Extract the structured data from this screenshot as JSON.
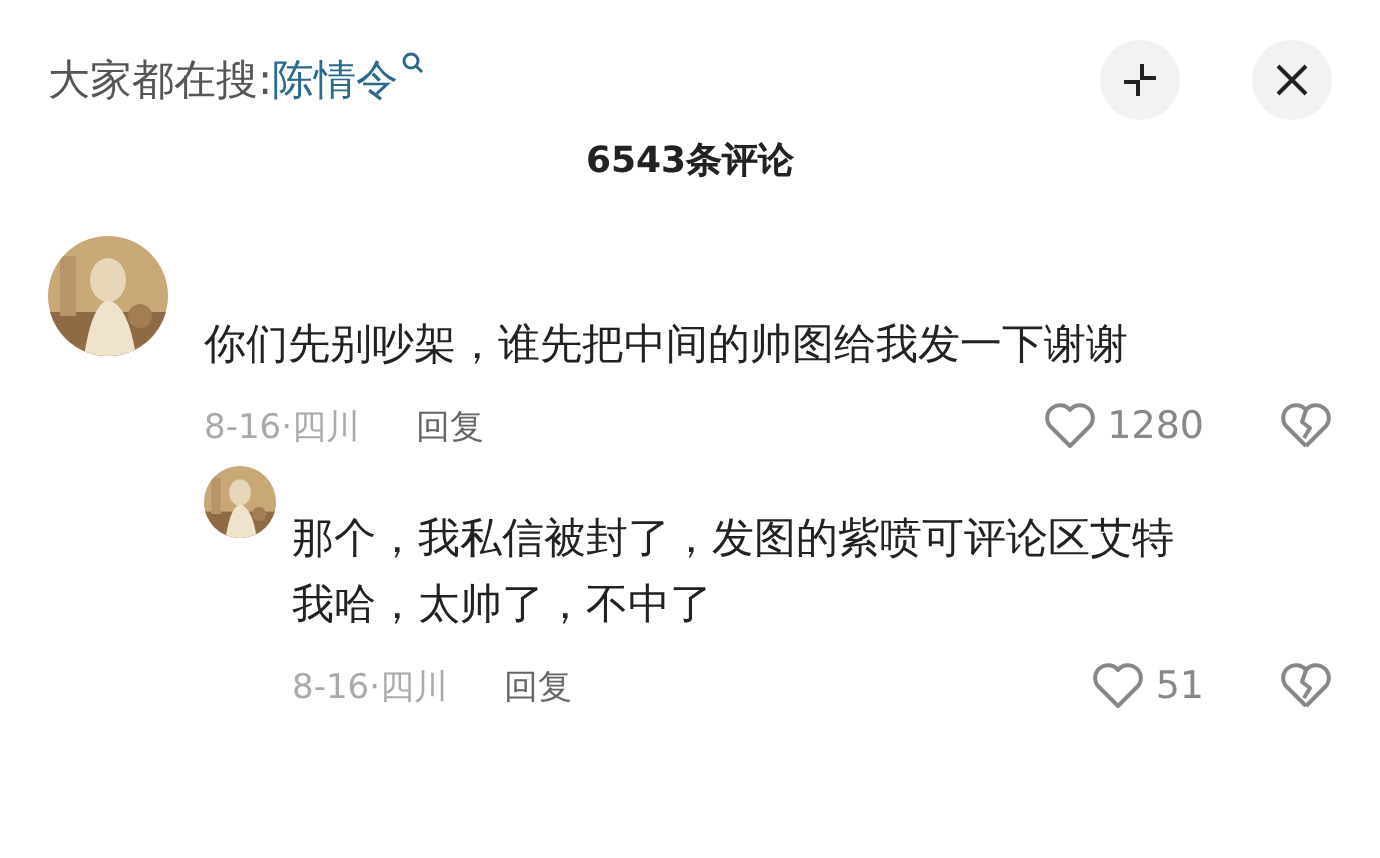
{
  "header": {
    "label": "大家都在搜:",
    "search_term": "陈情令"
  },
  "title": "6543条评论",
  "comments": [
    {
      "text": "你们先别吵架，谁先把中间的帅图给我发一下谢谢",
      "date_location": "8-16·四川",
      "reply": "回复",
      "likes": "1280",
      "replies": [
        {
          "text": "那个，我私信被封了，发图的紫喷可评论区艾特我哈，太帅了，不中了",
          "date_location": "8-16·四川",
          "reply": "回复",
          "likes": "51"
        }
      ]
    }
  ]
}
